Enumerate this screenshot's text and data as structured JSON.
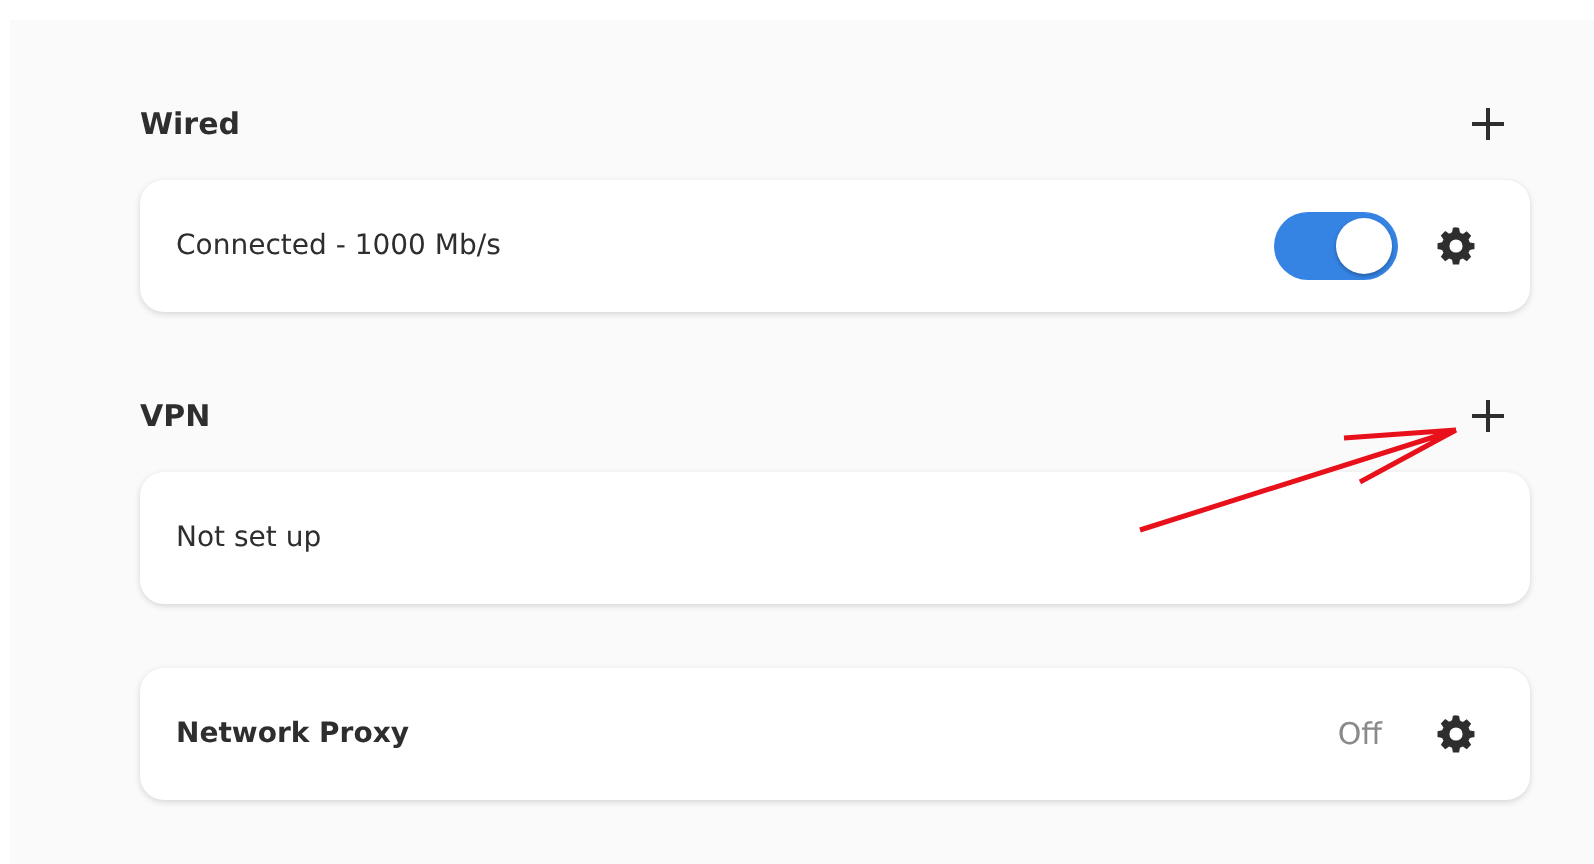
{
  "sections": [
    {
      "title": "Wired",
      "add_button": true,
      "rows": [
        {
          "kind": "toggle",
          "label": "Connected - 1000 Mb/s",
          "bold": false,
          "on": true,
          "settings": true
        }
      ]
    },
    {
      "title": "VPN",
      "add_button": true,
      "rows": [
        {
          "kind": "text",
          "label": "Not set up",
          "bold": false,
          "settings": false
        }
      ]
    },
    {
      "rows": [
        {
          "kind": "status",
          "label": "Network Proxy",
          "bold": true,
          "status": "Off",
          "settings": true
        }
      ]
    }
  ],
  "annotation": {
    "kind": "arrow"
  }
}
